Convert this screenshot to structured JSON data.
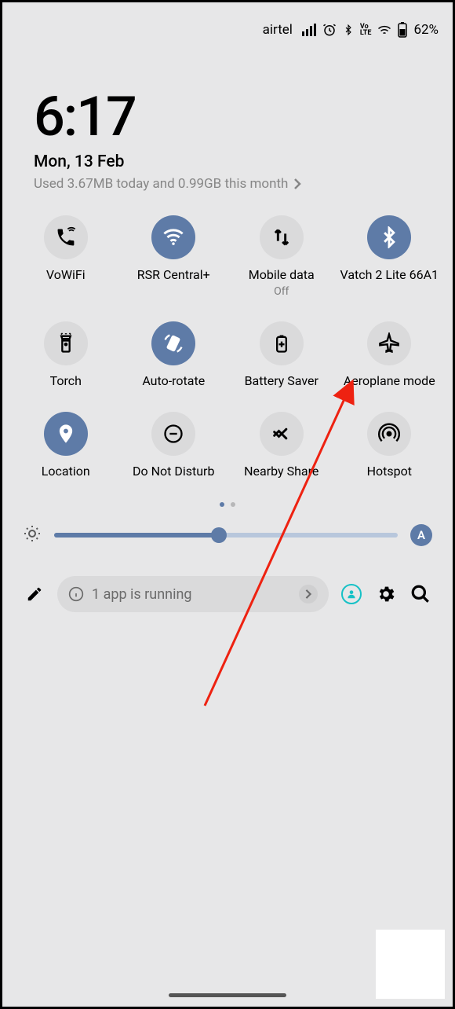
{
  "status": {
    "carrier": "airtel",
    "battery_pct": "62%"
  },
  "header": {
    "time": "6:17",
    "date": "Mon, 13 Feb",
    "usage": "Used 3.67MB today and 0.99GB this month"
  },
  "tiles": [
    {
      "label": "VoWiFi",
      "sub": "",
      "icon": "phone-wifi",
      "on": false
    },
    {
      "label": "RSR Central+",
      "sub": "",
      "icon": "wifi",
      "on": true
    },
    {
      "label": "Mobile data",
      "sub": "Off",
      "icon": "data-arrows",
      "on": false
    },
    {
      "label": "Vatch 2 Lite 66A1",
      "sub": "",
      "icon": "bluetooth",
      "on": true
    },
    {
      "label": "Torch",
      "sub": "",
      "icon": "flashlight",
      "on": false
    },
    {
      "label": "Auto-rotate",
      "sub": "",
      "icon": "rotate",
      "on": true
    },
    {
      "label": "Battery Saver",
      "sub": "",
      "icon": "battery-plus",
      "on": false
    },
    {
      "label": "Aeroplane mode",
      "sub": "",
      "icon": "airplane",
      "on": false
    },
    {
      "label": "Location",
      "sub": "",
      "icon": "pin",
      "on": true
    },
    {
      "label": "Do Not Disturb",
      "sub": "",
      "icon": "dnd",
      "on": false
    },
    {
      "label": "Nearby Share",
      "sub": "",
      "icon": "nearby",
      "on": false
    },
    {
      "label": "Hotspot",
      "sub": "",
      "icon": "hotspot",
      "on": false
    }
  ],
  "slider": {
    "auto_label": "A",
    "percent": 48
  },
  "bottom": {
    "running_text": "1 app is running"
  },
  "colors": {
    "accent": "#5e7ba7",
    "teal": "#17c1c6",
    "tile_off": "#dadadb",
    "bg": "#e7e7e8"
  }
}
